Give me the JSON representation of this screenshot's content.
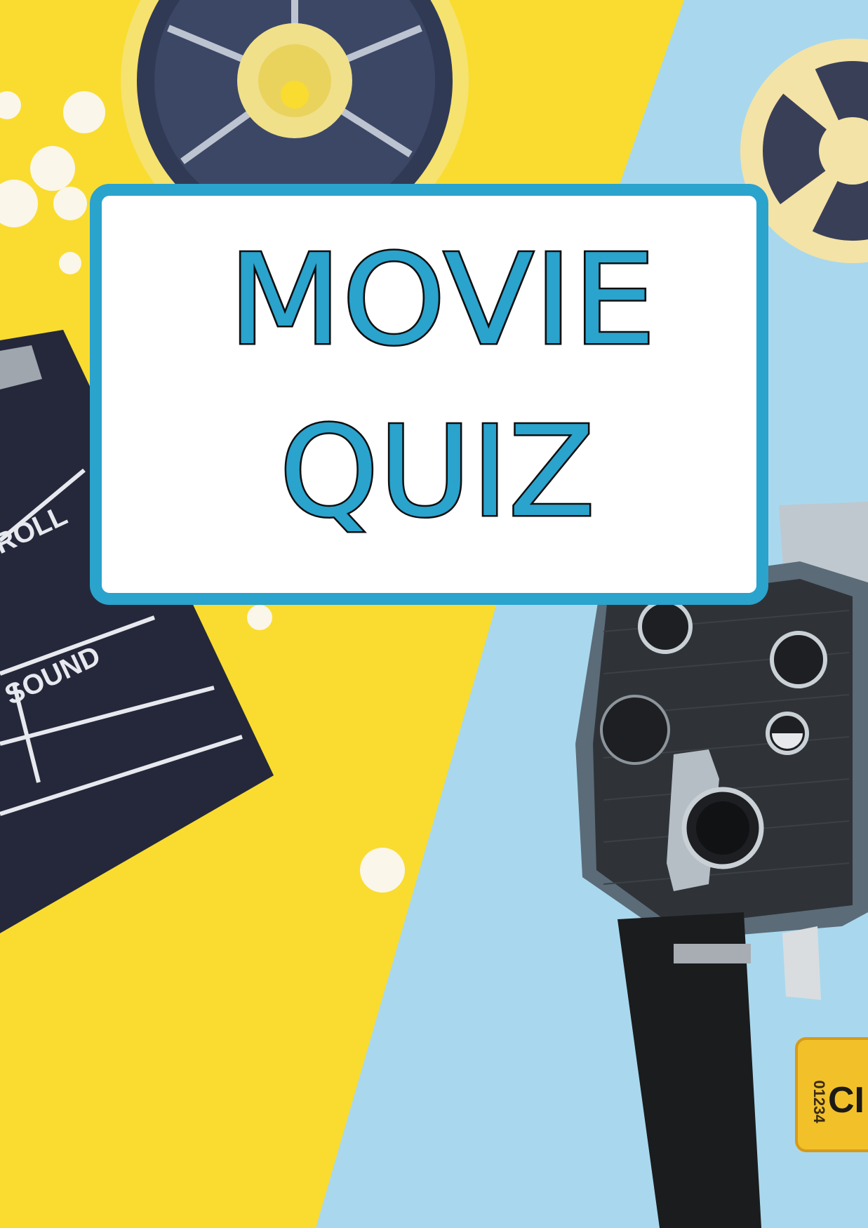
{
  "poster": {
    "title_line1": "MOVIE",
    "title_line2": "QUIZ"
  },
  "props": {
    "clapper_label_roll": "ROLL",
    "clapper_label_sound": "SOUND",
    "ticket_number": "01234",
    "ticket_text": "CI"
  },
  "colors": {
    "background_yellow": "#f9dc2f",
    "background_blue": "#a9d8ee",
    "accent_blue": "#2aa3cd",
    "outline_black": "#0f0f0f"
  },
  "icons": [
    "film-reel-icon",
    "popcorn-icon",
    "clapperboard-icon",
    "movie-camera-icon",
    "ticket-icon"
  ]
}
